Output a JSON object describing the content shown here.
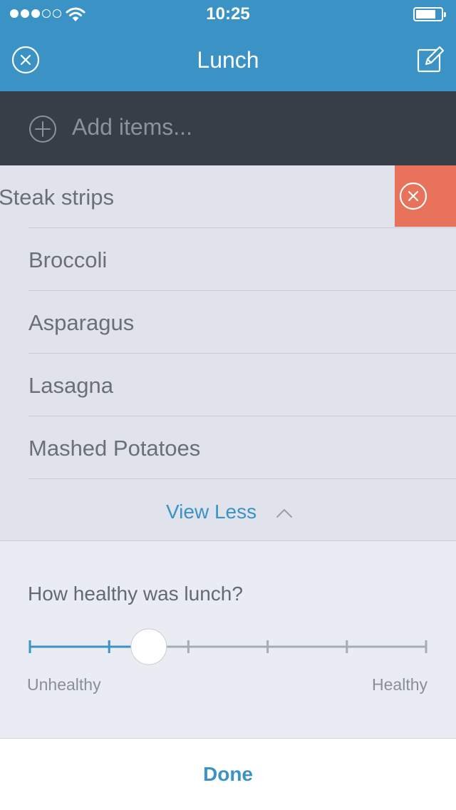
{
  "status_bar": {
    "time": "10:25",
    "signal_bars_filled": 3,
    "signal_bars_total": 5,
    "icons": [
      "signal-dots-icon",
      "wifi-icon",
      "battery-icon"
    ]
  },
  "nav": {
    "title": "Lunch",
    "close_icon": "close-circle-icon",
    "edit_icon": "edit-pencil-icon"
  },
  "add_items": {
    "placeholder": "Add items...",
    "icon": "plus-circle-icon"
  },
  "items": [
    {
      "label": "Steak strips",
      "swiped": true
    },
    {
      "label": "Broccoli"
    },
    {
      "label": "Asparagus"
    },
    {
      "label": "Lasagna"
    },
    {
      "label": "Mashed Potatoes"
    }
  ],
  "view_less": {
    "label": "View Less",
    "icon": "chevron-up-icon"
  },
  "rating": {
    "question": "How healthy was lunch?",
    "min_label": "Unhealthy",
    "max_label": "Healthy",
    "steps": 6,
    "value_fraction": 0.3
  },
  "footer": {
    "done_label": "Done"
  },
  "colors": {
    "accent": "#3a93c4",
    "dark_bar": "#373e48",
    "delete": "#e8735a",
    "list_bg": "#e0e3ec",
    "page_bg": "#e9ecf3"
  }
}
